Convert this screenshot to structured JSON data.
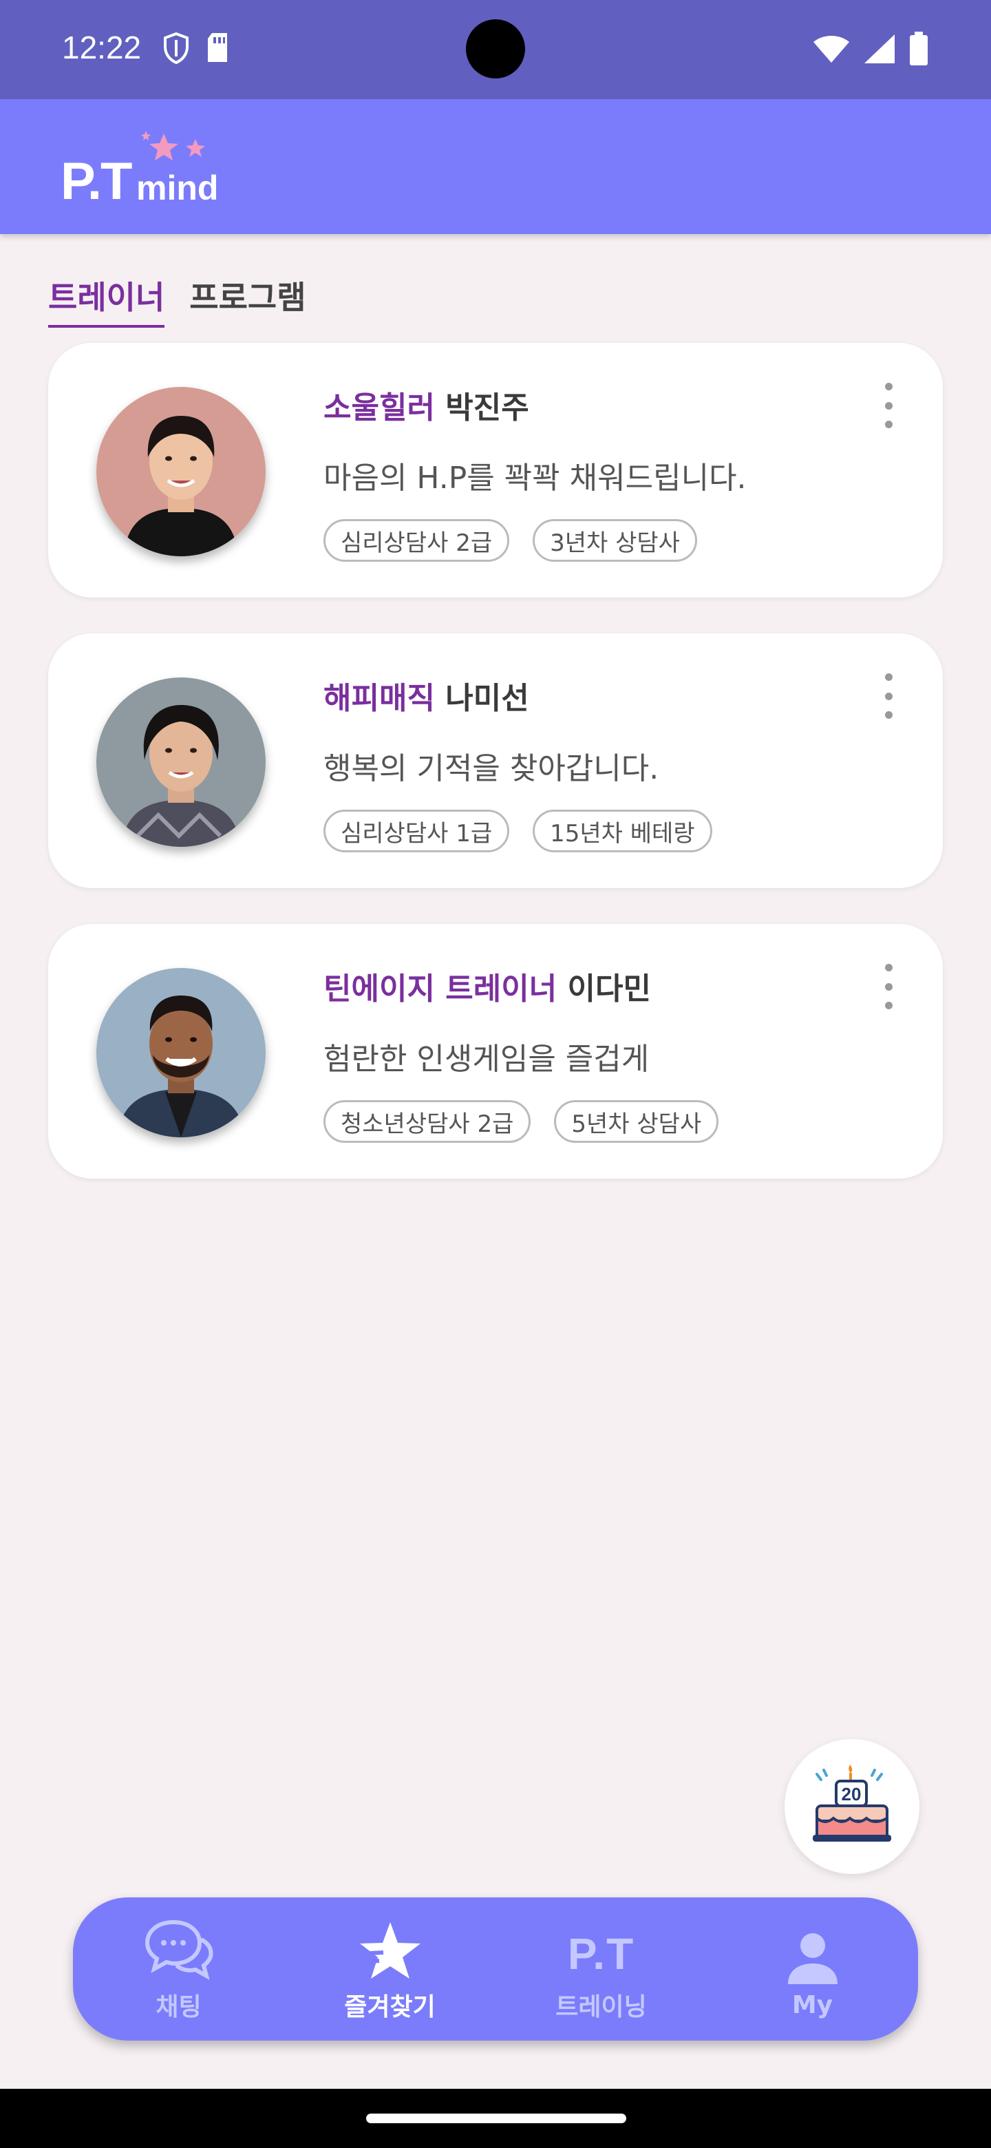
{
  "status_bar": {
    "time": "12:22"
  },
  "app_bar": {
    "logo_pt": "P.T",
    "logo_mind": "mind"
  },
  "tabs": [
    {
      "label": "트레이너",
      "active": true
    },
    {
      "label": "프로그램",
      "active": false
    }
  ],
  "trainers": [
    {
      "nickname": "소울힐러",
      "name": "박진주",
      "description": "마음의 H.P를 꽉꽉 채워드립니다.",
      "tags": [
        "심리상담사 2급",
        "3년차 상담사"
      ]
    },
    {
      "nickname": "해피매직",
      "name": "나미선",
      "description": "행복의 기적을 찾아갑니다.",
      "tags": [
        "심리상담사 1급",
        "15년차 베테랑"
      ]
    },
    {
      "nickname": "틴에이지 트레이너",
      "name": "이다민",
      "description": "험란한 인생게임을 즐겁게",
      "tags": [
        "청소년상담사 2급",
        "5년차 상담사"
      ]
    }
  ],
  "fab": {
    "cake_number": "20"
  },
  "bottom_nav": [
    {
      "label": "채팅",
      "icon": "chat-bubbles-icon",
      "active": false
    },
    {
      "label": "즐겨찾기",
      "icon": "star-icon",
      "active": true
    },
    {
      "label": "트레이닝",
      "icon": "pt-text-icon",
      "icon_text": "P.T",
      "active": false
    },
    {
      "label": "My",
      "icon": "person-icon",
      "active": false
    }
  ],
  "colors": {
    "status_bar": "#6160c0",
    "app_bar": "#7b7cfb",
    "accent_purple": "#7a2f9e",
    "background": "#f6f0f3",
    "nav_inactive": "#c4c8ff"
  }
}
